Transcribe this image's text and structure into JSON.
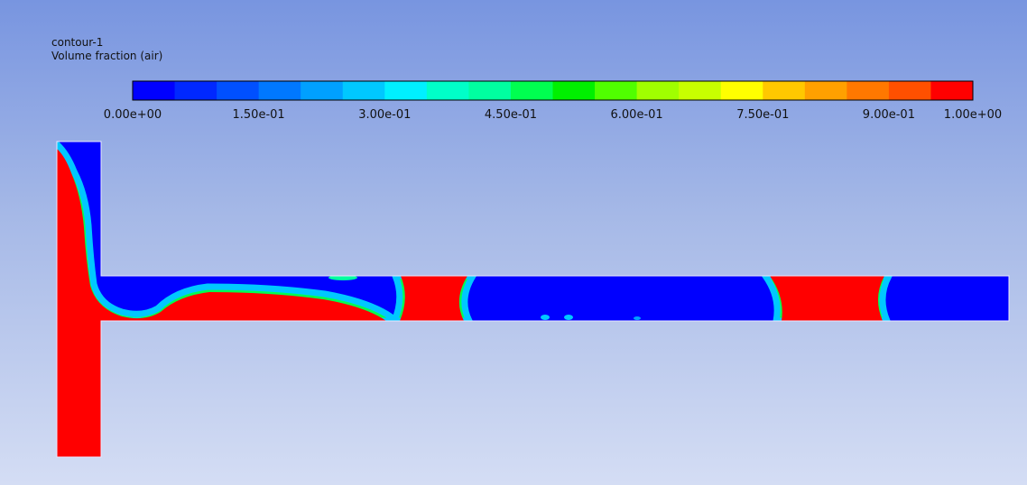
{
  "title": "contour-1",
  "subtitle": "Volume fraction (air)",
  "chart_data": {
    "type": "heatmap",
    "title": "contour-1",
    "subtitle": "Volume fraction (air)",
    "colorbar": {
      "min": 0.0,
      "max": 1.0,
      "levels": 20,
      "colors": [
        "#0000ff",
        "#0028ff",
        "#0050ff",
        "#0078ff",
        "#00a0ff",
        "#00c8ff",
        "#00f0ff",
        "#00ffc8",
        "#00ffa0",
        "#00ff50",
        "#00f000",
        "#50ff00",
        "#a0ff00",
        "#c8ff00",
        "#ffff00",
        "#ffc800",
        "#ffa000",
        "#ff7800",
        "#ff5000",
        "#ff0000"
      ],
      "tick_values": [
        0.0,
        0.15,
        0.3,
        0.45,
        0.6,
        0.75,
        0.9,
        1.0
      ],
      "tick_labels": [
        "0.00e+00",
        "1.50e-01",
        "3.00e-01",
        "4.50e-01",
        "6.00e-01",
        "7.50e-01",
        "9.00e-01",
        "1.00e+00"
      ]
    },
    "field": {
      "air_color": "#ff0000",
      "water_color": "#0000ff",
      "interface_color": "#00ff50"
    }
  }
}
